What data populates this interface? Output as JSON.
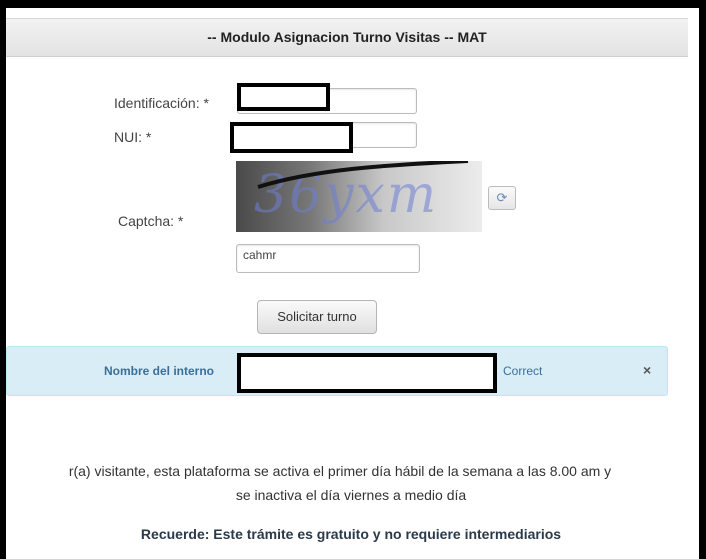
{
  "header": {
    "title": "-- Modulo Asignacion Turno Visitas -- MAT"
  },
  "form": {
    "identificacion_label": "Identificación: *",
    "nui_label": "NUI: *",
    "captcha_label": "Captcha: *",
    "captcha_image_text": "36yxm",
    "captcha_value": "cahmr",
    "submit_label": "Solicitar turno",
    "refresh_icon": "refresh-icon"
  },
  "alert": {
    "label": "Nombre del interno",
    "status": "Correct",
    "close": "×"
  },
  "notice": {
    "line1": "r(a) visitante, esta plataforma se activa el primer día hábil de la semana a las 8.00 am y",
    "line2": "se inactiva el día viernes a medio día"
  },
  "reminder": "Recuerde: Este trámite es gratuito y no requiere intermediarios"
}
